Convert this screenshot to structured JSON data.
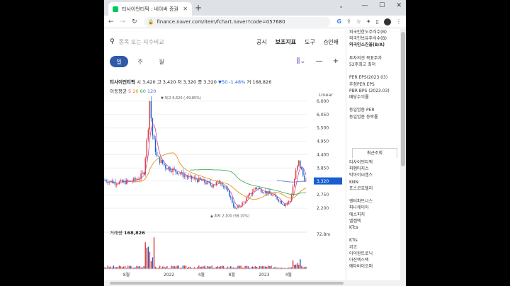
{
  "tab": {
    "title": "티사이언티픽 : 네이버 증권"
  },
  "address": {
    "url": "finance.naver.com/item/fchart.naver?code=057680"
  },
  "toolbar": {
    "search_placeholder": "종목 또는 지수비교",
    "links": [
      "공시",
      "보조지표",
      "도구",
      "인쇄"
    ]
  },
  "period": {
    "tabs": [
      "일",
      "주",
      "월"
    ],
    "selected": "일"
  },
  "stock": {
    "name": "티사이언티픽",
    "open_label": "시",
    "open": "3,420",
    "high_label": "고",
    "high": "3,420",
    "low_label": "저",
    "low": "3,320",
    "close_label": "종",
    "close": "3,320",
    "change": "▼50 -1.48%",
    "vol_label": "거",
    "volume": "168,826"
  },
  "ma": {
    "label": "이동평균",
    "periods": [
      "5",
      "20",
      "60",
      "120"
    ]
  },
  "scale": "Linear",
  "chart_data": {
    "type": "candlestick",
    "y_ticks": [
      "6,600",
      "6,050",
      "5,500",
      "4,950",
      "4,400",
      "3,850",
      "3,320",
      "2,750",
      "2,200"
    ],
    "x_ticks": [
      "8월",
      "2022",
      "4월",
      "8월",
      "2023",
      "4월"
    ],
    "max_label": "최고 6,620 (-49.85%)",
    "min_label": "최저 2,100 (58.10%)",
    "last_price": "3,320",
    "ylim": [
      2000,
      6800
    ],
    "colors": {
      "up": "#e03b3b",
      "down": "#1a5fd1"
    },
    "volume": {
      "label": "거래량",
      "value": "168,826",
      "max_tick": "72.8m"
    }
  },
  "sidebar": {
    "items": [
      "외국인한도주식수(B)",
      "외국인보유주식수(B)",
      "외국인소진율(B/A)",
      "",
      "투자의견 목표주가",
      "52주최고 최저",
      "",
      "PER EPS(2023.03)",
      "추정PER EPS",
      "PBR BPS (2023.03)",
      "배당수익률",
      "",
      "동일업종 PER",
      "동일업종 등락률"
    ],
    "recent_title": "최근조회",
    "recent": [
      "티사이언티픽",
      "파멥타지스",
      "박아이씨엠스",
      "KNN",
      "포스코호텔리",
      "",
      "엔터파트너스",
      "파나케이아",
      "에스피지",
      "엘켐텍",
      "KTcs",
      "",
      "KTis",
      "위코",
      "아이원트로닉",
      "아진엑스텍",
      "에타바이오퍼"
    ]
  }
}
